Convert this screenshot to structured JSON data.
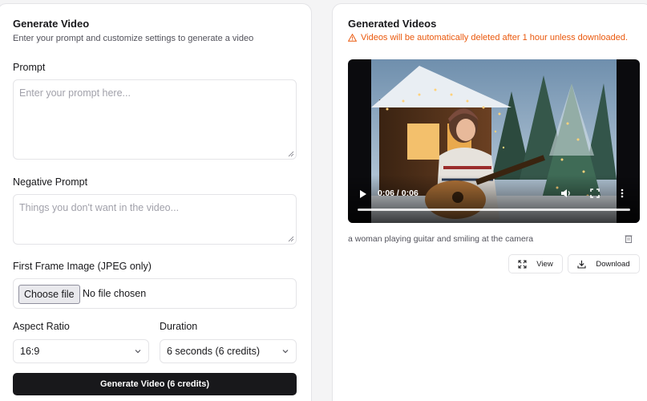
{
  "left_panel": {
    "title": "Generate Video",
    "subtitle": "Enter your prompt and customize settings to generate a video",
    "prompt": {
      "label": "Prompt",
      "value": "",
      "placeholder": "Enter your prompt here..."
    },
    "negative_prompt": {
      "label": "Negative Prompt",
      "value": "",
      "placeholder": "Things you don't want in the video..."
    },
    "first_frame": {
      "label": "First Frame Image (JPEG only)",
      "button_label": "Choose file",
      "status": "No file chosen"
    },
    "aspect_ratio": {
      "label": "Aspect Ratio",
      "selected": "16:9"
    },
    "duration": {
      "label": "Duration",
      "selected": "6 seconds (6 credits)"
    },
    "generate_button": "Generate Video (6 credits)"
  },
  "right_panel": {
    "title": "Generated Videos",
    "warning": "Videos will be automatically deleted after 1 hour unless downloaded.",
    "video": {
      "time": "0:06 / 0:06",
      "progress": 1.0,
      "caption": "a woman playing guitar and smiling at the camera"
    },
    "view_button": "View",
    "download_button": "Download"
  },
  "colors": {
    "primary": "#18181b",
    "warning": "#ea580c",
    "border": "#e4e4e7",
    "muted_text": "#52525b",
    "placeholder": "#a1a1aa"
  },
  "icons": [
    "warning-icon",
    "play-icon",
    "volume-icon",
    "fullscreen-icon",
    "more-icon",
    "trash-icon",
    "expand-icon",
    "download-icon",
    "chevron-down-icon"
  ]
}
